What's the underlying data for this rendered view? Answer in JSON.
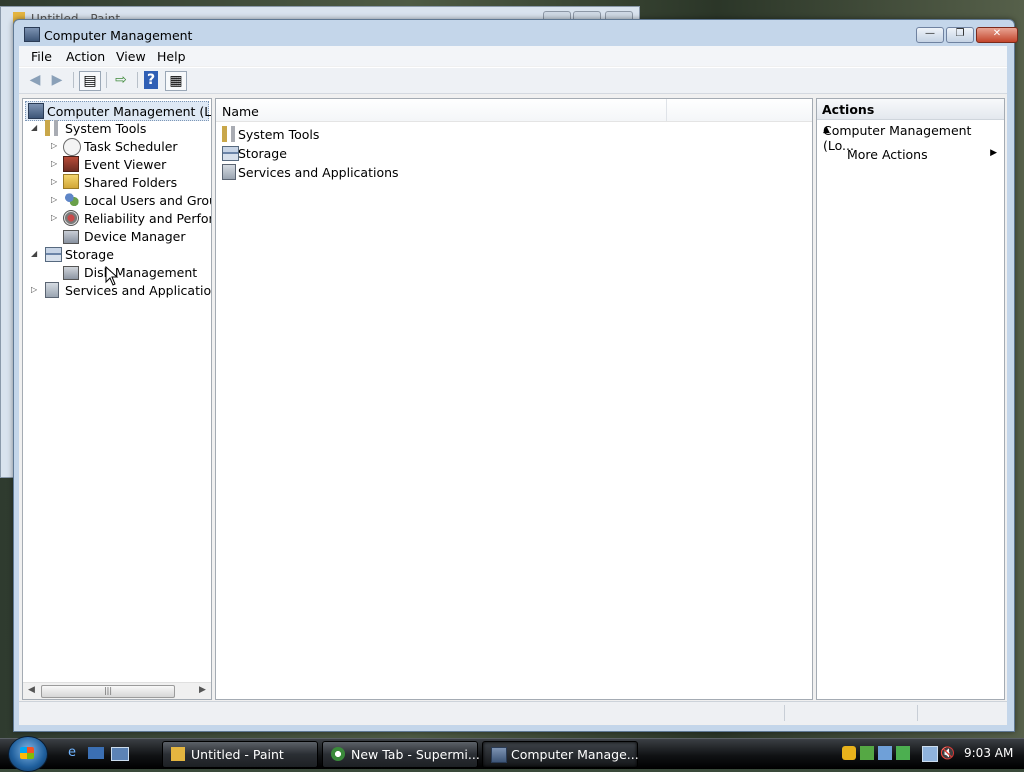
{
  "background_window": {
    "title": "Untitled - Paint"
  },
  "window": {
    "title": "Computer Management",
    "buttons": {
      "minimize": "—",
      "maximize": "❐",
      "close": "✕"
    }
  },
  "menu": [
    "File",
    "Action",
    "View",
    "Help"
  ],
  "toolbar": {
    "back_icon": "back-arrow-icon",
    "forward_icon": "forward-arrow-icon",
    "show_hide_tree_icon": "console-tree-icon",
    "export_icon": "export-list-icon",
    "help_icon": "help-icon",
    "action_pane_icon": "action-pane-icon"
  },
  "tree": {
    "root": "Computer Management (Local",
    "items": [
      {
        "label": "System Tools",
        "level": 1,
        "expander": "◢"
      },
      {
        "label": "Task Scheduler",
        "level": 2,
        "expander": "▷"
      },
      {
        "label": "Event Viewer",
        "level": 2,
        "expander": "▷"
      },
      {
        "label": "Shared Folders",
        "level": 2,
        "expander": "▷"
      },
      {
        "label": "Local Users and Groups",
        "level": 2,
        "expander": "▷"
      },
      {
        "label": "Reliability and Performa",
        "level": 2,
        "expander": "▷"
      },
      {
        "label": "Device Manager",
        "level": 2,
        "expander": ""
      },
      {
        "label": "Storage",
        "level": 1,
        "expander": "◢"
      },
      {
        "label": "Disk Management",
        "level": 2,
        "expander": ""
      },
      {
        "label": "Services and Applications",
        "level": 1,
        "expander": "▷"
      }
    ]
  },
  "list": {
    "column_name": "Name",
    "rows": [
      "System Tools",
      "Storage",
      "Services and Applications"
    ]
  },
  "actions": {
    "header": "Actions",
    "section": "Computer Management (Lo...",
    "items": [
      "More Actions"
    ]
  },
  "taskbar": {
    "tasks": [
      "Untitled - Paint",
      "New Tab - Supermi...",
      "Computer Manage..."
    ],
    "clock": "9:03 AM"
  }
}
